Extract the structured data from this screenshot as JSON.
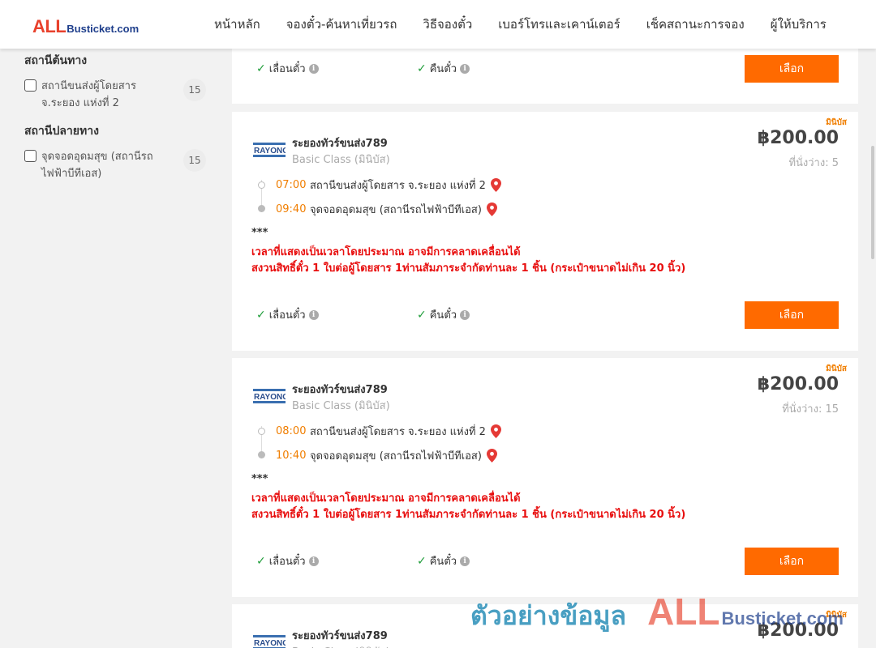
{
  "header": {
    "logo_all": "ALL",
    "logo_rest": "Busticket.com",
    "nav": [
      "หน้าหลัก",
      "จองตั๋ว-ค้นหาเที่ยวรถ",
      "วิธีจองตั๋ว",
      "เบอร์โทรและเคาน์เตอร์",
      "เช็คสถานะการจอง",
      "ผู้ให้บริการ"
    ]
  },
  "filters": {
    "origin": {
      "title": "สถานีต้นทาง",
      "label": "สถานีขนส่งผู้โดยสาร จ.ระยอง แห่งที่ 2",
      "count": "15"
    },
    "destination": {
      "title": "สถานีปลายทาง",
      "label": "จุดจอดอุดมสุข (สถานีรถไฟฟ้าบีทีเอส)",
      "count": "15"
    }
  },
  "common": {
    "badge": "มินิบัส",
    "operator": "ระยองทัวร์ขนส่ง789",
    "bus_class": "Basic Class (มินิบัส)",
    "price": "฿200.00",
    "stars": "***",
    "note1": "เวลาที่แสดงเป็นเวลาโดยประมาณ อาจมีการคลาดเคลื่อนได้",
    "note2": "สงวนสิทธิ์ตั๋ว 1 ใบต่อผู้โดยสาร 1ท่านสัมภาระจำกัดท่านละ 1 ชิ้น (กระเป๋าขนาดไม่เกิน 20 นิ้ว)",
    "feature_postpone": "เลื่อนตั๋ว",
    "feature_refund": "คืนตั๋ว",
    "select_label": "เลือก",
    "info_glyph": "i",
    "check_glyph": "✓"
  },
  "trips": [
    {
      "dep_time": "07:00",
      "dep_station": "สถานีขนส่งผู้โดยสาร จ.ระยอง แห่งที่ 2",
      "arr_time": "09:40",
      "arr_station": "จุดจอดอุดมสุข (สถานีรถไฟฟ้าบีทีเอส)",
      "seats": "ที่นั่งว่าง: 5"
    },
    {
      "dep_time": "08:00",
      "dep_station": "สถานีขนส่งผู้โดยสาร จ.ระยอง แห่งที่ 2",
      "arr_time": "10:40",
      "arr_station": "จุดจอดอุดมสุข (สถานีรถไฟฟ้าบีทีเอส)",
      "seats": "ที่นั่งว่าง: 15"
    },
    {
      "seats": ""
    }
  ],
  "watermark": {
    "text_th": "ตัวอย่างข้อมูล",
    "all": "ALL",
    "rest": "Busticket.com"
  },
  "colors": {
    "accent": "#ff6a00",
    "time": "#f07e00",
    "alert": "#e80f0f",
    "check": "#1f9d3a",
    "brand_red": "#e8412c",
    "brand_blue": "#1f3f8c"
  }
}
